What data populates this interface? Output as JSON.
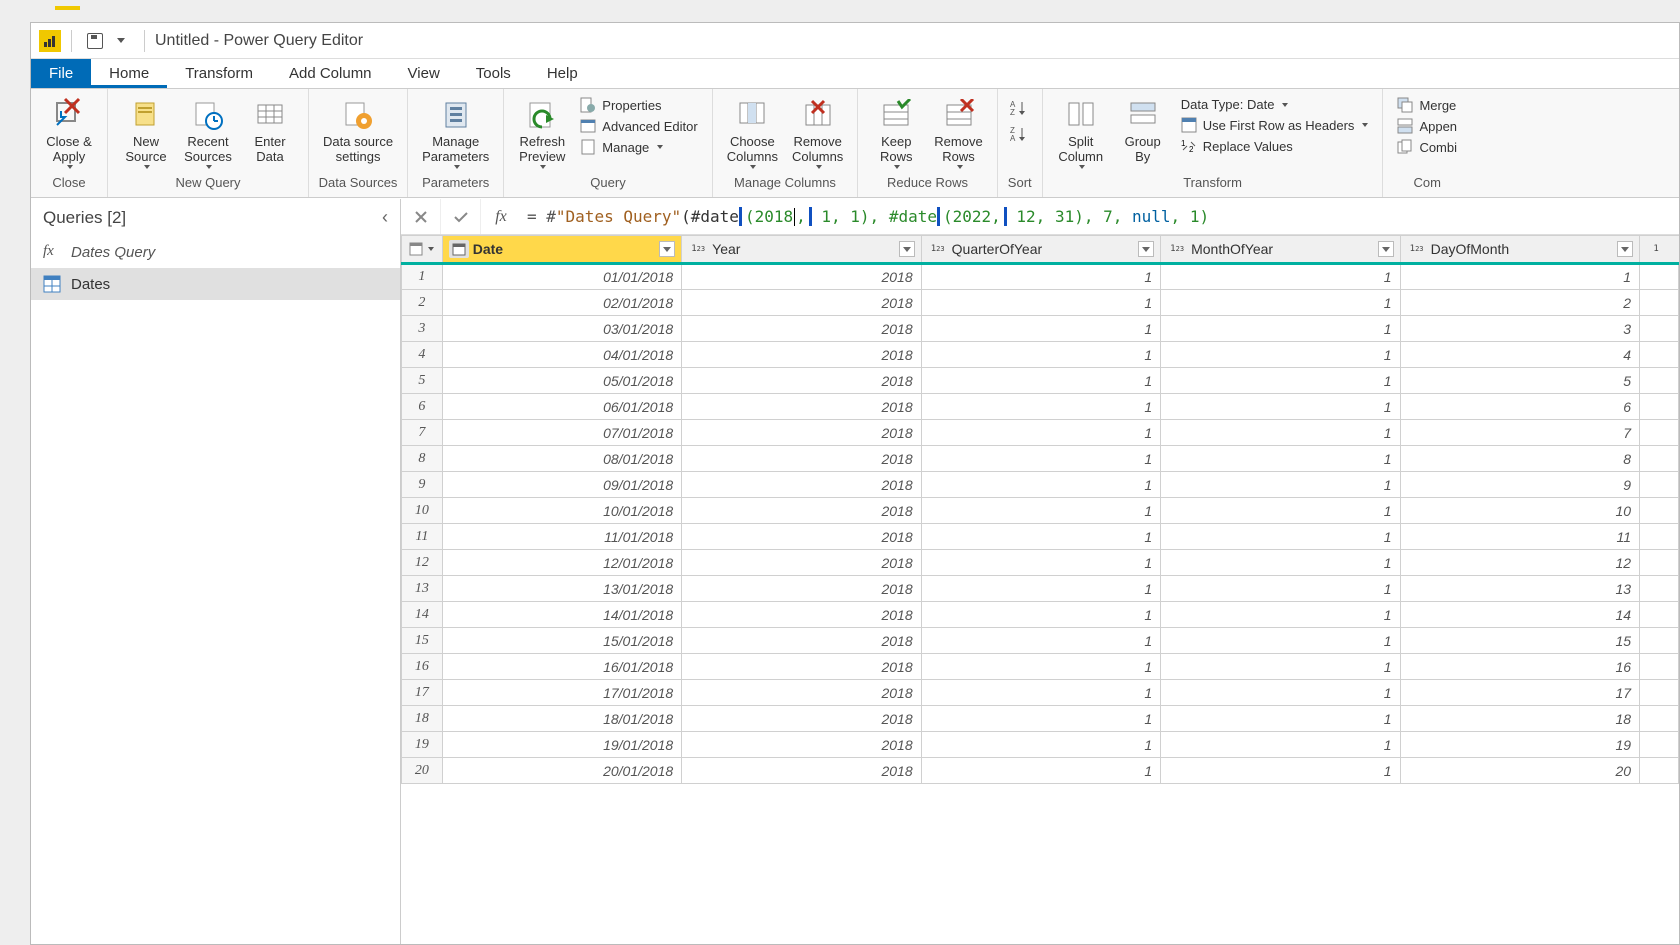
{
  "window": {
    "title": "Untitled - Power Query Editor"
  },
  "tabs": {
    "file": "File",
    "home": "Home",
    "transform": "Transform",
    "addcol": "Add Column",
    "view": "View",
    "tools": "Tools",
    "help": "Help"
  },
  "ribbon": {
    "close": {
      "closeApply": "Close &\nApply",
      "group": "Close"
    },
    "newQuery": {
      "newSource": "New\nSource",
      "recent": "Recent\nSources",
      "enter": "Enter\nData",
      "group": "New Query"
    },
    "dataSources": {
      "settings": "Data source\nsettings",
      "group": "Data Sources"
    },
    "params": {
      "manage": "Manage\nParameters",
      "group": "Parameters"
    },
    "query": {
      "refresh": "Refresh\nPreview",
      "properties": "Properties",
      "advanced": "Advanced Editor",
      "manageQ": "Manage",
      "group": "Query"
    },
    "manageCols": {
      "choose": "Choose\nColumns",
      "remove": "Remove\nColumns",
      "group": "Manage Columns"
    },
    "reduceRows": {
      "keep": "Keep\nRows",
      "remove": "Remove\nRows",
      "group": "Reduce Rows"
    },
    "sort": {
      "group": "Sort"
    },
    "transform": {
      "split": "Split\nColumn",
      "group": "Group\nBy",
      "dataType": "Data Type: Date",
      "firstRow": "Use First Row as Headers",
      "replace": "Replace Values",
      "groupLbl": "Transform"
    },
    "combine": {
      "merge": "Merge",
      "append": "Appen",
      "combi": "Combi",
      "group": "Com"
    }
  },
  "queries": {
    "header": "Queries [2]",
    "items": [
      {
        "name": "Dates Query",
        "type": "fx"
      },
      {
        "name": "Dates",
        "type": "table"
      }
    ]
  },
  "formula": {
    "prefix": "= #",
    "string": "\"Dates Query\"",
    "mid1": "(#date",
    "h1": "(2018,",
    "mid2": " 1, 1), #date",
    "h2": "(2022,",
    "mid3": " 12, 31), 7, ",
    "kw": "null",
    "end": ", 1)"
  },
  "columns": [
    "Date",
    "Year",
    "QuarterOfYear",
    "MonthOfYear",
    "DayOfMonth"
  ],
  "rows": [
    {
      "n": 1,
      "d": "01/01/2018",
      "y": "2018",
      "q": "1",
      "m": "1",
      "day": "1"
    },
    {
      "n": 2,
      "d": "02/01/2018",
      "y": "2018",
      "q": "1",
      "m": "1",
      "day": "2"
    },
    {
      "n": 3,
      "d": "03/01/2018",
      "y": "2018",
      "q": "1",
      "m": "1",
      "day": "3"
    },
    {
      "n": 4,
      "d": "04/01/2018",
      "y": "2018",
      "q": "1",
      "m": "1",
      "day": "4"
    },
    {
      "n": 5,
      "d": "05/01/2018",
      "y": "2018",
      "q": "1",
      "m": "1",
      "day": "5"
    },
    {
      "n": 6,
      "d": "06/01/2018",
      "y": "2018",
      "q": "1",
      "m": "1",
      "day": "6"
    },
    {
      "n": 7,
      "d": "07/01/2018",
      "y": "2018",
      "q": "1",
      "m": "1",
      "day": "7"
    },
    {
      "n": 8,
      "d": "08/01/2018",
      "y": "2018",
      "q": "1",
      "m": "1",
      "day": "8"
    },
    {
      "n": 9,
      "d": "09/01/2018",
      "y": "2018",
      "q": "1",
      "m": "1",
      "day": "9"
    },
    {
      "n": 10,
      "d": "10/01/2018",
      "y": "2018",
      "q": "1",
      "m": "1",
      "day": "10"
    },
    {
      "n": 11,
      "d": "11/01/2018",
      "y": "2018",
      "q": "1",
      "m": "1",
      "day": "11"
    },
    {
      "n": 12,
      "d": "12/01/2018",
      "y": "2018",
      "q": "1",
      "m": "1",
      "day": "12"
    },
    {
      "n": 13,
      "d": "13/01/2018",
      "y": "2018",
      "q": "1",
      "m": "1",
      "day": "13"
    },
    {
      "n": 14,
      "d": "14/01/2018",
      "y": "2018",
      "q": "1",
      "m": "1",
      "day": "14"
    },
    {
      "n": 15,
      "d": "15/01/2018",
      "y": "2018",
      "q": "1",
      "m": "1",
      "day": "15"
    },
    {
      "n": 16,
      "d": "16/01/2018",
      "y": "2018",
      "q": "1",
      "m": "1",
      "day": "16"
    },
    {
      "n": 17,
      "d": "17/01/2018",
      "y": "2018",
      "q": "1",
      "m": "1",
      "day": "17"
    },
    {
      "n": 18,
      "d": "18/01/2018",
      "y": "2018",
      "q": "1",
      "m": "1",
      "day": "18"
    },
    {
      "n": 19,
      "d": "19/01/2018",
      "y": "2018",
      "q": "1",
      "m": "1",
      "day": "19"
    },
    {
      "n": 20,
      "d": "20/01/2018",
      "y": "2018",
      "q": "1",
      "m": "1",
      "day": "20"
    }
  ]
}
